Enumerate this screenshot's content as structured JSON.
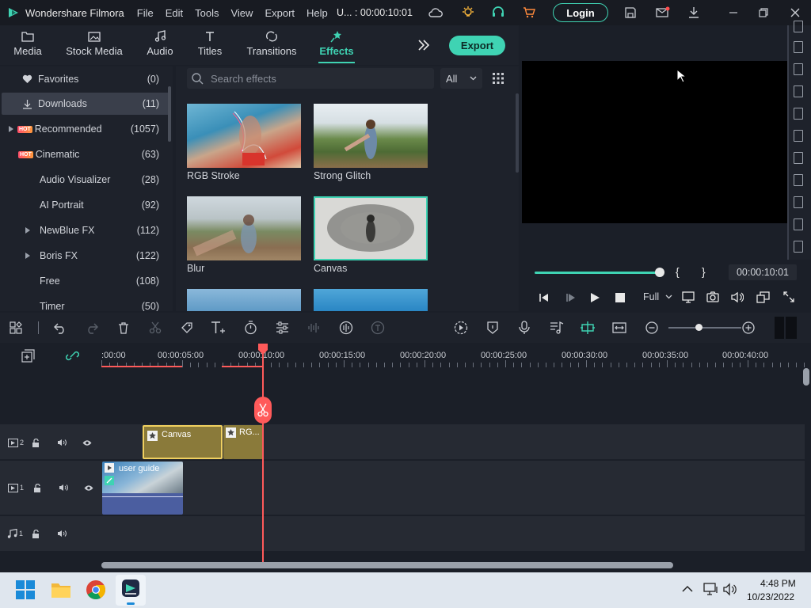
{
  "app": {
    "name": "Wondershare Filmora",
    "timecode_title": "U... : 00:00:10:01"
  },
  "menu": [
    "File",
    "Edit",
    "Tools",
    "View",
    "Export",
    "Help"
  ],
  "login_label": "Login",
  "tabs": [
    {
      "label": "Media",
      "icon": "folder-icon"
    },
    {
      "label": "Stock Media",
      "icon": "stock-media-icon"
    },
    {
      "label": "Audio",
      "icon": "music-note-icon"
    },
    {
      "label": "Titles",
      "icon": "text-icon"
    },
    {
      "label": "Transitions",
      "icon": "transitions-icon"
    },
    {
      "label": "Effects",
      "icon": "effects-icon",
      "active": true
    }
  ],
  "export_label": "Export",
  "sidebar": [
    {
      "label": "Favorites",
      "count": "(0)",
      "icon": "heart-icon"
    },
    {
      "label": "Downloads",
      "count": "(11)",
      "icon": "download-icon",
      "selected": true
    },
    {
      "label": "Recommended",
      "count": "(1057)",
      "hot": true,
      "expand": true
    },
    {
      "label": "Cinematic",
      "count": "(63)",
      "hot": true
    },
    {
      "label": "Audio Visualizer",
      "count": "(28)"
    },
    {
      "label": "AI Portrait",
      "count": "(92)"
    },
    {
      "label": "NewBlue FX",
      "count": "(112)",
      "expand": true
    },
    {
      "label": "Boris FX",
      "count": "(122)",
      "expand": true
    },
    {
      "label": "Free",
      "count": "(108)"
    },
    {
      "label": "Timer",
      "count": "(50)"
    }
  ],
  "hot_badge": "HOT",
  "search": {
    "placeholder": "Search effects",
    "filter": "All"
  },
  "effects": [
    {
      "label": "RGB Stroke"
    },
    {
      "label": "Strong Glitch"
    },
    {
      "label": "Blur"
    },
    {
      "label": "Canvas",
      "selected": true
    }
  ],
  "preview": {
    "time": "00:00:10:01",
    "quality": "Full",
    "progress": 1.0
  },
  "ruler_labels": [
    ":00:00",
    "00:00:05:00",
    "00:00:10:00",
    "00:00:15:00",
    "00:00:20:00",
    "00:00:25:00",
    "00:00:30:00",
    "00:00:35:00",
    "00:00:40:00"
  ],
  "tracks": [
    {
      "id": "2",
      "type": "video"
    },
    {
      "id": "1",
      "type": "video"
    },
    {
      "id": "1",
      "type": "audio"
    }
  ],
  "clips": {
    "canvas": "Canvas",
    "rgb": "RG...",
    "video": "user guide"
  },
  "taskbar": {
    "time": "4:48 PM",
    "date": "10/23/2022"
  },
  "colors": {
    "accent": "#3fd3b3",
    "playhead": "#ff5a5a",
    "effect_clip": "#8a7a3a",
    "video_clip": "#4b5ea0"
  }
}
